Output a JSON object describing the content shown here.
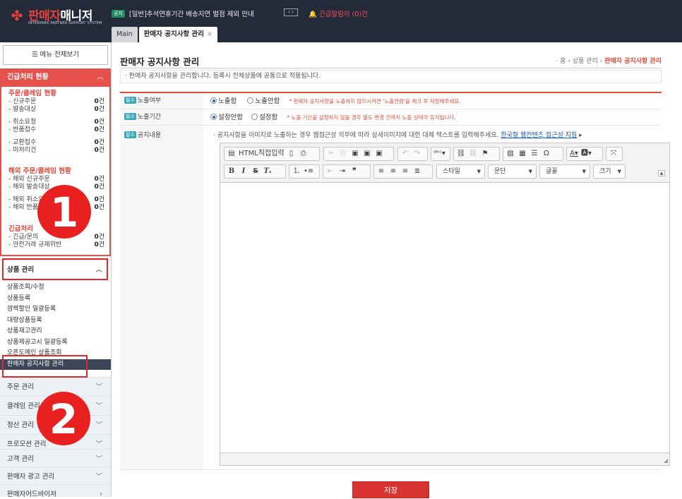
{
  "topbar": {
    "logo_title": "판매자매니저",
    "logo_title_red": "판매자",
    "logo_title_white": "매니저",
    "logo_sub": "INTERPARK PARTNER SUPPORT SYSTEM",
    "notice_badge": "공지",
    "notice_text": "[일반]추석연휴기간 배송지연 벌점 제외 안내",
    "notice_nav": "‹ ›",
    "urgent_alert": "긴급알림이 (0)건"
  },
  "tabs": [
    {
      "label": "Main"
    },
    {
      "label": "판매자 공지사항 관리",
      "close": "×"
    }
  ],
  "sidebar": {
    "menu_all": "메뉴 전체보기",
    "urgent_title": "긴급처리 현황",
    "groups": [
      {
        "title": "주문/클레임 현황",
        "rows": [
          {
            "label": "- 신규주문",
            "count": "0",
            "unit": "건"
          },
          {
            "label": "- 발송대상",
            "count": "0",
            "unit": "건"
          },
          {
            "label": "- 취소요청",
            "count": "0",
            "unit": "건"
          },
          {
            "label": "- 반품접수",
            "count": "0",
            "unit": "건"
          },
          {
            "label": "- 교환접수",
            "count": "0",
            "unit": "건"
          },
          {
            "label": "- 미처리건",
            "count": "0",
            "unit": "건"
          }
        ]
      },
      {
        "title": "해외 주문/클레임 현황",
        "rows": [
          {
            "label": "- 해외 신규주문",
            "count": "0",
            "unit": "건"
          },
          {
            "label": "- 해외 발송대상",
            "count": "0",
            "unit": "건"
          },
          {
            "label": "- 해외 취소요청",
            "count": "0",
            "unit": "건"
          },
          {
            "label": "- 해외 반품접수",
            "count": "0",
            "unit": "건"
          }
        ]
      },
      {
        "title": "긴급처리",
        "rows": [
          {
            "label": "- 긴급/문의",
            "count": "0",
            "unit": "건"
          },
          {
            "label": "- 안전거래 규제위반",
            "count": "0",
            "unit": "건"
          }
        ]
      }
    ],
    "product_section": "상품 관리",
    "product_items": [
      "상품조회/수정",
      "상품등록",
      "깜짝할인 일괄등록",
      "대량상품등록",
      "상품재고관리",
      "상품제공고시 일괄등록",
      "오픈도메인 상품조회",
      "판매자 공지사항 관리"
    ],
    "other_sections": [
      "주문 관리",
      "클레임 관리",
      "정산 관리",
      "프로모션 관리",
      "고객 관리",
      "판매자 광고 관리",
      "판매자어드바이저"
    ]
  },
  "annotations": {
    "badge1": "1",
    "badge2": "2"
  },
  "main": {
    "title": "판매자 공지사항 관리",
    "breadcrumb": {
      "home": "홈",
      "section": "상품 관리",
      "current": "판매자 공지사항 관리"
    },
    "description": "판매자 공지사항을 관리합니다. 등록시 전체상품에 공통으로 적용됩니다.",
    "required_badge": "필수",
    "exposure": {
      "label": "노출여부",
      "options": [
        "노출함",
        "노출안함"
      ],
      "selected": 0,
      "hint": "* 판매자 공지사항을 노출하지 않으시려면 '노출안함'을 체크 후 저장해주세요."
    },
    "period": {
      "label": "노출기간",
      "options": [
        "설정안함",
        "설정함"
      ],
      "selected": 0,
      "hint": "* 노출 기간을 설정하지 않을 경우 별도 변경 전까지 노출 상태가 유지됩니다."
    },
    "content": {
      "label": "공지내용",
      "info": "· 공지사항을 이미지로 노출하는 경우 웹접근성 의무에 따라 상세이미지에 대한 대체 텍스트를 입력해주세요.",
      "link": "한국형 웹컨텐츠 접근성 지침",
      "link_arrow": "▸"
    },
    "editor": {
      "html_button": "HTML직접입력",
      "style_select": "스타일",
      "format_select": "문단",
      "font_select": "글꼴",
      "size_select": "크기"
    },
    "save_button": "저장"
  }
}
